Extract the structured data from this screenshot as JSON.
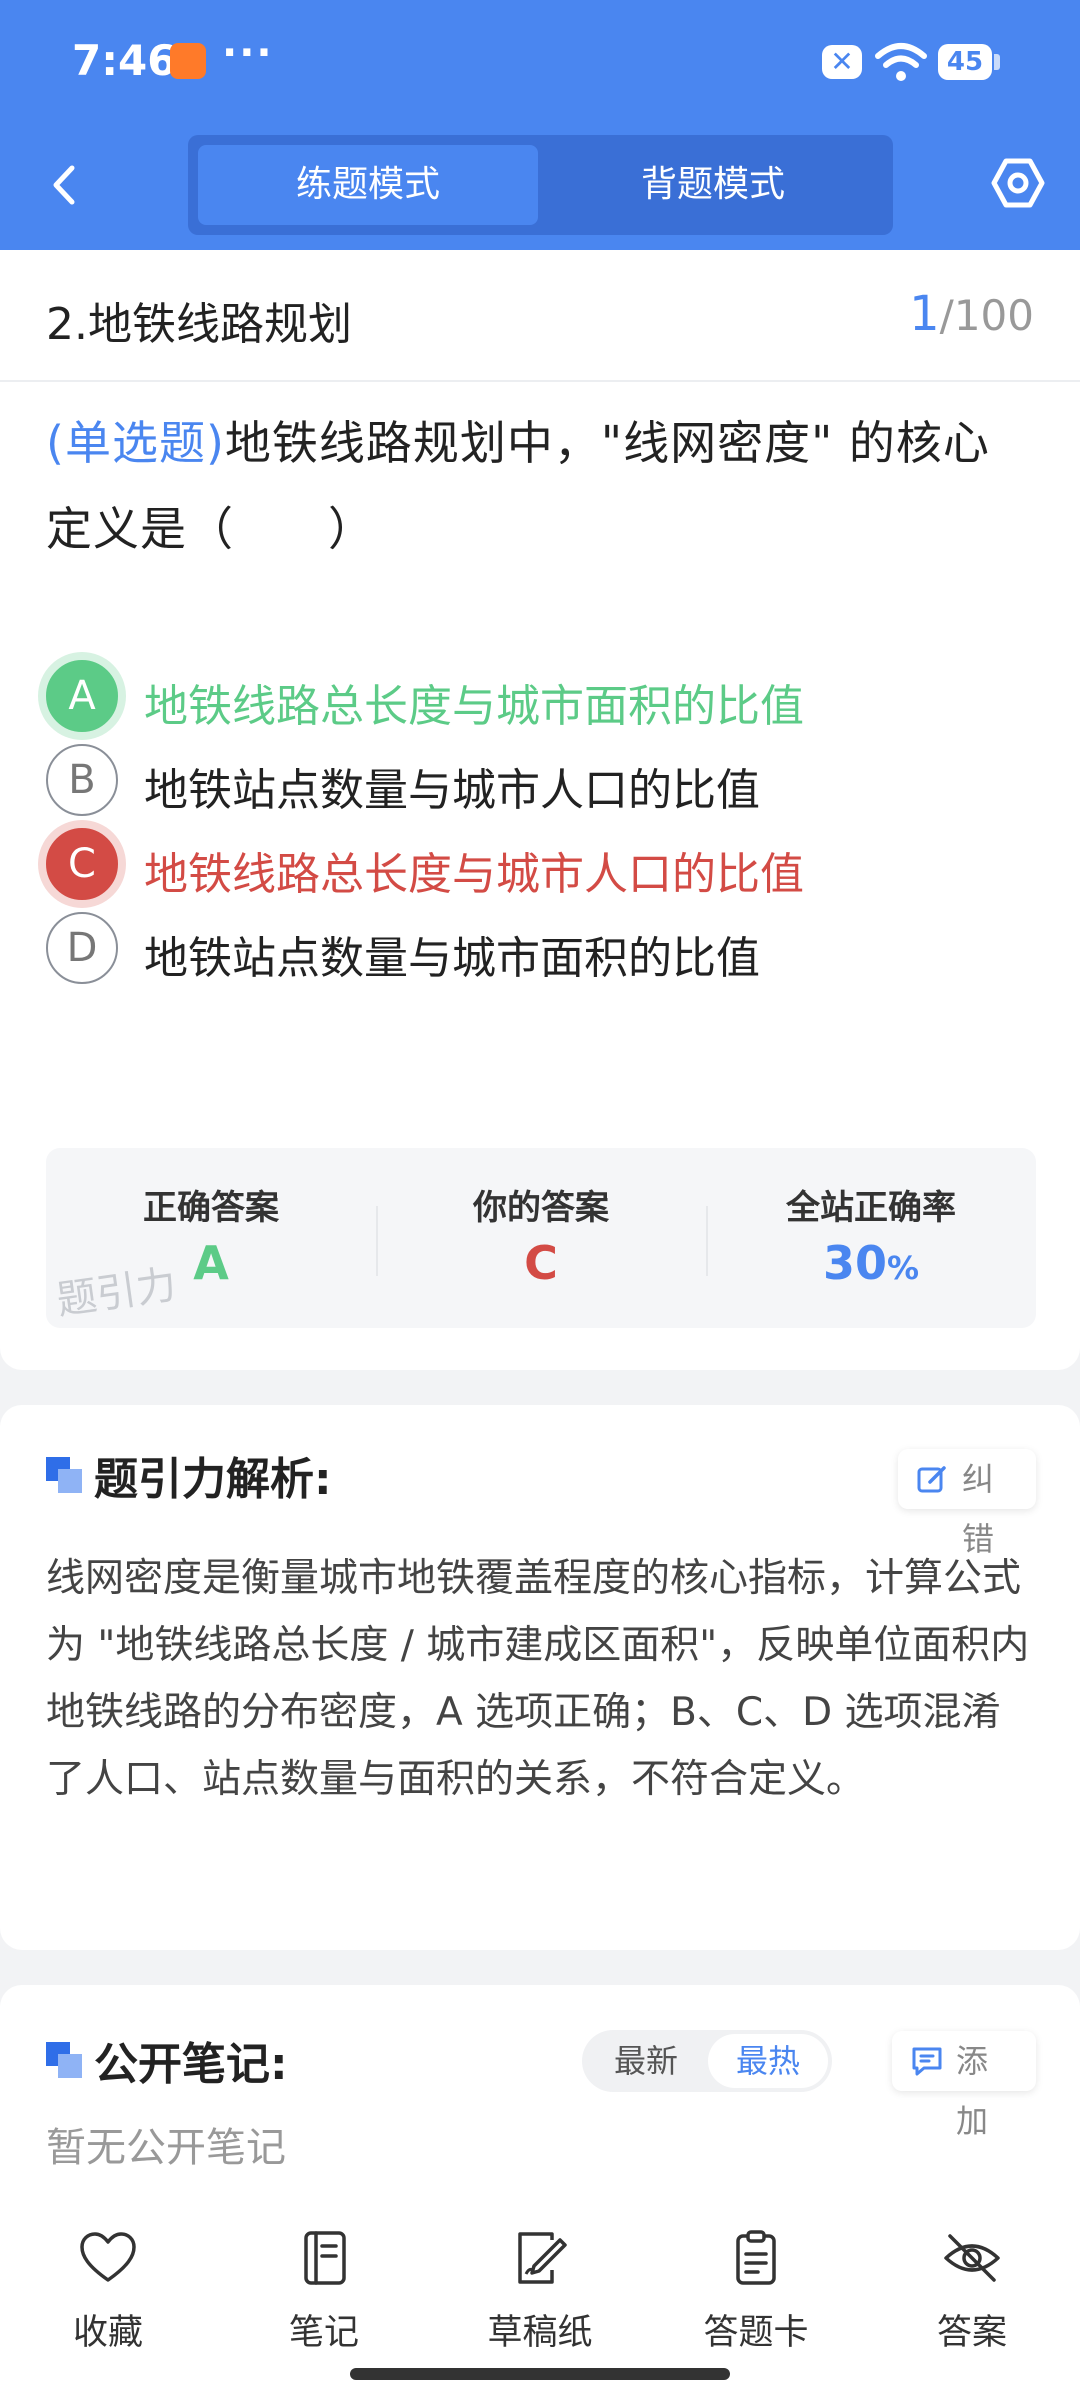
{
  "status_bar": {
    "time": "7:46",
    "dots": "···",
    "battery": "45"
  },
  "header": {
    "modes": [
      {
        "label": "练题模式",
        "active": true
      },
      {
        "label": "背题模式",
        "active": false
      }
    ]
  },
  "question": {
    "title": "2.地铁线路规划",
    "current": "1",
    "total": "/100",
    "type": "(单选题)",
    "stem": "地铁线路规划中，\"线网密度\" 的核心定义是（　　）",
    "options": [
      {
        "key": "A",
        "text": "地铁线路总长度与城市面积的比值",
        "state": "correct"
      },
      {
        "key": "B",
        "text": "地铁站点数量与城市人口的比值",
        "state": "normal"
      },
      {
        "key": "C",
        "text": "地铁线路总长度与城市人口的比值",
        "state": "wrong"
      },
      {
        "key": "D",
        "text": "地铁站点数量与城市面积的比值",
        "state": "normal"
      }
    ]
  },
  "answer_summary": {
    "correct_label": "正确答案",
    "correct_value": "A",
    "yours_label": "你的答案",
    "yours_value": "C",
    "rate_label": "全站正确率",
    "rate_value": "30",
    "rate_unit": "%",
    "watermark": "题引力",
    "colors": {
      "correct": "#5ccb87",
      "wrong": "#d34b45",
      "accent": "#4a86f0"
    }
  },
  "analysis": {
    "title": "题引力解析:",
    "report_label": "纠错",
    "text": "线网密度是衡量城市地铁覆盖程度的核心指标，计算公式为 \"地铁线路总长度 / 城市建成区面积\"，反映单位面积内地铁线路的分布密度，A 选项正确；B、C、D 选项混淆了人口、站点数量与面积的关系，不符合定义。"
  },
  "notes": {
    "title": "公开笔记:",
    "sort": [
      {
        "label": "最新",
        "active": false
      },
      {
        "label": "最热",
        "active": true
      }
    ],
    "add_label": "添加",
    "empty_text": "暂无公开笔记"
  },
  "bottom_nav": [
    {
      "label": "收藏",
      "icon": "heart-icon"
    },
    {
      "label": "笔记",
      "icon": "notebook-icon"
    },
    {
      "label": "草稿纸",
      "icon": "draft-icon"
    },
    {
      "label": "答题卡",
      "icon": "clipboard-icon"
    },
    {
      "label": "答案",
      "icon": "eye-off-icon"
    }
  ]
}
